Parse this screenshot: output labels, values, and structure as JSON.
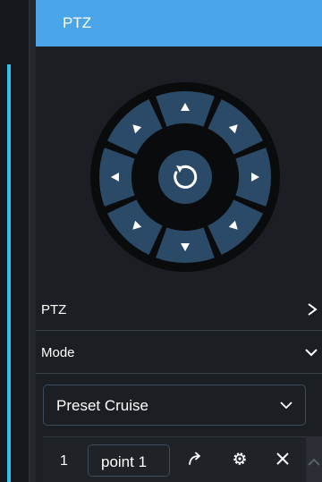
{
  "header": {
    "title": "PTZ"
  },
  "sections": {
    "ptz": {
      "label": "PTZ"
    },
    "mode": {
      "label": "Mode"
    }
  },
  "mode_select": {
    "value": "Preset Cruise"
  },
  "cruise_points": [
    {
      "index": "1",
      "name": "point 1"
    }
  ],
  "colors": {
    "header": "#4aa5e8",
    "accent": "#36c0e6",
    "dial_segment": "#2b4a68",
    "dial_ring": "#0a0b0d",
    "panel": "#1b1e22"
  },
  "icons": {
    "joystick": [
      "arrow-up-icon",
      "arrow-up-right-icon",
      "arrow-right-icon",
      "arrow-down-right-icon",
      "arrow-down-icon",
      "arrow-down-left-icon",
      "arrow-left-icon",
      "arrow-up-left-icon",
      "reset-icon"
    ],
    "rows": [
      "chevron-right-icon",
      "chevron-down-icon"
    ],
    "cruise": [
      "goto-icon",
      "gear-icon",
      "close-icon"
    ]
  }
}
